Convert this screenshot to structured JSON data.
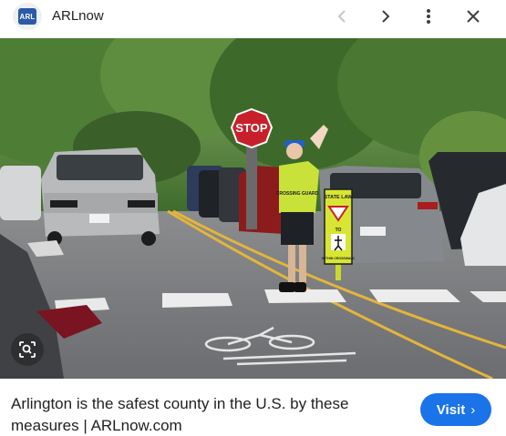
{
  "header": {
    "logo_text": "ARL",
    "site_name": "ARLnow",
    "prev_icon": "chevron-left-icon",
    "next_icon": "chevron-right-icon",
    "more_icon": "more-vert-icon",
    "close_icon": "close-icon"
  },
  "image": {
    "stop_sign_text": "STOP",
    "vest_text": "CROSSING GUARD",
    "sign_top": "STATE LAW",
    "sign_to": "TO",
    "sign_bottom": "WITHIN CROSSWALK",
    "lens_icon": "lens-search-icon"
  },
  "caption": {
    "title": "Arlington is the safest county in the U.S. by these measures | ARLnow.com"
  },
  "visit": {
    "label": "Visit",
    "chevron": "›"
  },
  "colors": {
    "accent": "#1a73e8",
    "logo_bg": "#2a5aa8"
  }
}
